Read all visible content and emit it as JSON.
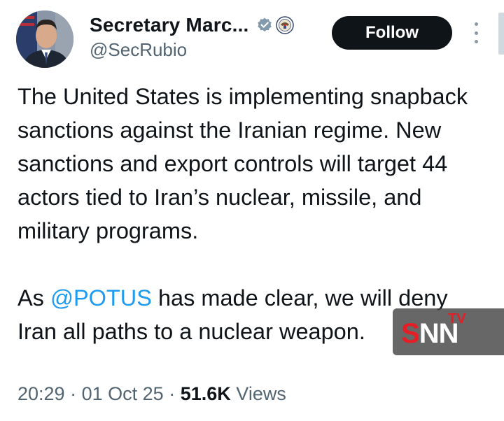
{
  "author": {
    "display_name": "Secretary Marc...",
    "handle": "@SecRubio",
    "avatar_icon": "profile-photo"
  },
  "actions": {
    "follow_label": "Follow",
    "more_icon": "more-vertical-icon"
  },
  "tweet": {
    "paragraph1": "The United States is implementing snapback sanctions against the Iranian regime. New sanctions and export controls will target 44 actors tied to Iran’s nuclear, missile, and military programs.",
    "paragraph2_before": "As ",
    "mention": "@POTUS",
    "paragraph2_after": " has made clear, we will deny Iran all paths to a nuclear weapon."
  },
  "meta": {
    "time": "20:29",
    "date": "01 Oct 25",
    "separator": "·",
    "views_count": "51.6K",
    "views_label": "Views"
  },
  "watermark": {
    "s_letter": "S",
    "nn_letters": "NN",
    "tv_label": "TV"
  },
  "colors": {
    "text": "#0f1419",
    "secondary": "#536471",
    "mention": "#1d9bf0",
    "verified_badge": "#829aab",
    "follow_button": "#0f1419",
    "watermark_red": "#e31e24"
  }
}
